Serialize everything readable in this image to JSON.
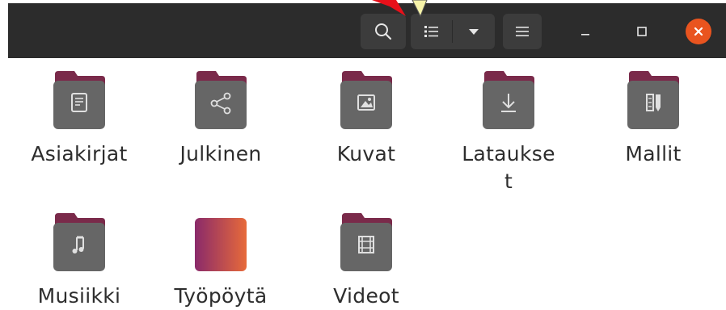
{
  "headerbar": {
    "search_icon": "search-icon",
    "view_list_icon": "list-view-icon",
    "view_dropdown_icon": "chevron-down-icon",
    "menu_icon": "hamburger-menu-icon",
    "minimize_icon": "minimize-icon",
    "maximize_icon": "maximize-icon",
    "close_icon": "close-icon",
    "close_color": "#e9541f"
  },
  "folders": [
    {
      "label": "Asiakirjat",
      "emblem": "document-icon"
    },
    {
      "label": "Julkinen",
      "emblem": "share-icon"
    },
    {
      "label": "Kuvat",
      "emblem": "picture-icon"
    },
    {
      "label": "Latauks",
      "label2": "e",
      "label3": "t",
      "emblem": "download-icon"
    },
    {
      "label": "Mallit",
      "emblem": "template-icon"
    },
    {
      "label": "Musiikki",
      "emblem": "music-icon"
    },
    {
      "label": "Työpöytä",
      "emblem": "desktop-icon"
    },
    {
      "label": "Videot",
      "emblem": "video-icon"
    }
  ],
  "colors": {
    "header": "#2c2c2c",
    "folder_tab": "#7a2a4a",
    "folder_body": "#666666",
    "desktop_gradient_start": "#8a2a6a",
    "desktop_gradient_end": "#e76a3a"
  }
}
